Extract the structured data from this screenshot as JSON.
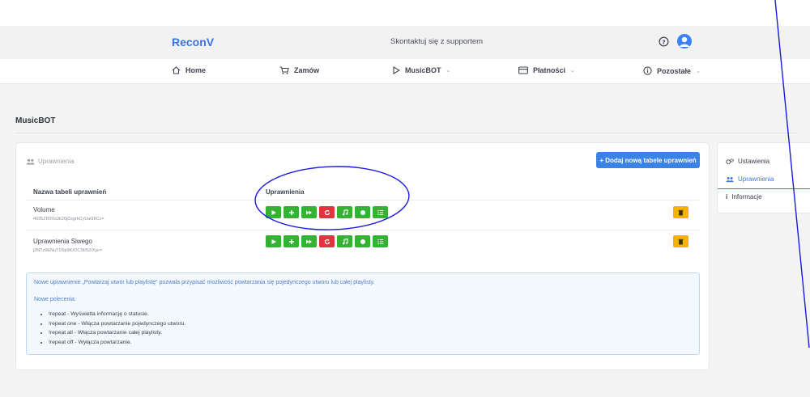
{
  "header": {
    "brand": "ReconV",
    "support_text": "Skontaktuj się z supportem",
    "brand_color": "#3b74e6"
  },
  "nav": {
    "items": [
      {
        "label": "Home",
        "icon": "home-icon",
        "dropdown": false
      },
      {
        "label": "Zamów",
        "icon": "cart-icon",
        "dropdown": false
      },
      {
        "label": "MusicBOT",
        "icon": "play-icon",
        "dropdown": true
      },
      {
        "label": "Płatności",
        "icon": "card-icon",
        "dropdown": true
      },
      {
        "label": "Pozostałe",
        "icon": "info-circle-icon",
        "dropdown": true
      }
    ]
  },
  "page": {
    "title": "MusicBOT"
  },
  "card": {
    "header": "Uprawnienia",
    "add_button": "+ Dodaj nową tabele uprawnień",
    "columns": [
      "Nazwa tabeli uprawnień",
      "Uprawnienia"
    ],
    "rows": [
      {
        "name": "Volume",
        "id": "4035ZR9Vs3k26jDzgrkCyUaG6Cc="
      },
      {
        "name": "Uprawnienia Siwego",
        "id": "j2NTz9ENuTD5p9lOOCSt/52/Xyc="
      }
    ],
    "permission_buttons": [
      {
        "icon": "play-icon",
        "color": "#34b233"
      },
      {
        "icon": "plus-icon",
        "color": "#34b233"
      },
      {
        "icon": "fast-forward-icon",
        "color": "#34b233"
      },
      {
        "icon": "repeat-icon",
        "color": "#e0343f"
      },
      {
        "icon": "music-note-icon",
        "color": "#34b233"
      },
      {
        "icon": "record-icon",
        "color": "#34b233"
      },
      {
        "icon": "list-icon",
        "color": "#34b233"
      }
    ]
  },
  "info": {
    "line1": "Nowe uprawnienie „Powtarzaj utwór lub playlistę” pozwala przypisać możliwość powtarzania się pojedynczego utworu lub całej playlisty.",
    "line2": "Nowe polecenia:",
    "commands": [
      "!repeat - Wyświetla informację o statusie.",
      "!repeat one - Włącza powtarzanie pojedynczego utworu.",
      "!repeat all - Włącza powtarzanie całej playlisty.",
      "!repeat off - Wyłącza powtarzanie."
    ]
  },
  "sidebar": {
    "items": [
      {
        "label": "Ustawienia",
        "icon": "gears-icon",
        "active": false
      },
      {
        "label": "Uprawnienia",
        "icon": "users-icon",
        "active": true
      },
      {
        "label": "Informacje",
        "icon": "info-icon",
        "active": false
      }
    ]
  }
}
